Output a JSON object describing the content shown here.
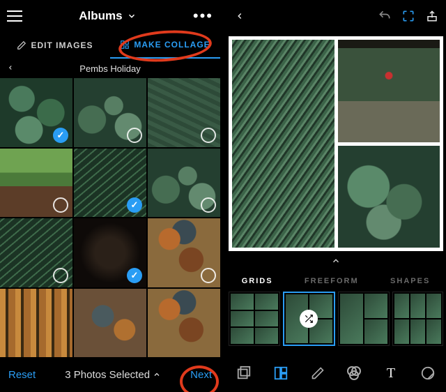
{
  "left": {
    "title": "Albums",
    "tabs": {
      "edit": "EDIT IMAGES",
      "collage": "MAKE COLLAGE"
    },
    "album_name": "Pembs Holiday",
    "grid_items": [
      {
        "selected": true
      },
      {
        "selected": false
      },
      {
        "selected": false
      },
      {
        "selected": false
      },
      {
        "selected": true
      },
      {
        "selected": false
      },
      {
        "selected": false
      },
      {
        "selected": true
      },
      {
        "selected": false
      },
      {
        "selected": null
      },
      {
        "selected": null
      },
      {
        "selected": null
      }
    ],
    "footer": {
      "reset": "Reset",
      "count_label": "3 Photos Selected",
      "next": "Next"
    }
  },
  "right": {
    "tabs": {
      "grids": "GRIDS",
      "freeform": "FREEFORM",
      "shapes": "SHAPES"
    },
    "active_tab": "grids",
    "toolbar": {
      "aspect": "aspect-ratio",
      "layout": "layout-grid",
      "edit": "pencil",
      "filter": "filters",
      "text": "T",
      "sticker": "sticker"
    }
  }
}
